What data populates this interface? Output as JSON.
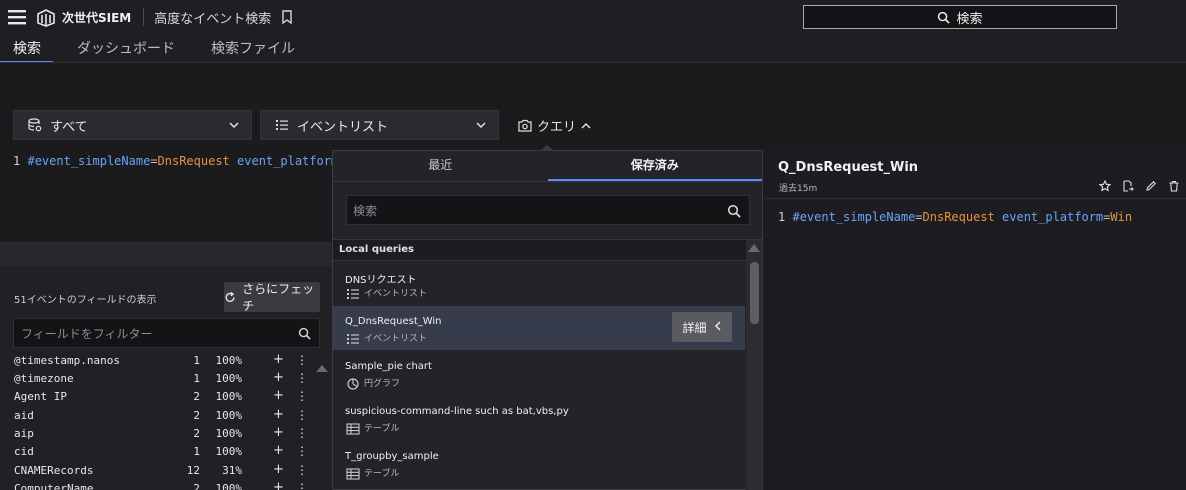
{
  "header": {
    "brand": "次世代SIEM",
    "page_title": "高度なイベント検索",
    "global_search_label": "検索"
  },
  "nav_tabs": [
    {
      "label": "検索",
      "active": true
    },
    {
      "label": "ダッシュボード",
      "active": false
    },
    {
      "label": "検索ファイル",
      "active": false
    }
  ],
  "controls": {
    "repo_select": "すべて",
    "view_select": "イベントリスト",
    "query_toggle": "クエリ"
  },
  "editor": {
    "line_number": "1",
    "tokens": [
      {
        "type": "kw",
        "text": "#event_simpleName"
      },
      {
        "type": "op",
        "text": "="
      },
      {
        "type": "val",
        "text": "DnsRequest"
      },
      {
        "type": "op",
        "text": " "
      },
      {
        "type": "kw",
        "text": "event_platform"
      },
      {
        "type": "op",
        "text": "="
      }
    ]
  },
  "fields": {
    "count_label": "51イベントのフィールドの表示",
    "fetch_label": "さらにフェッチ",
    "filter_placeholder": "フィールドをフィルター",
    "rows": [
      {
        "name": "@timestamp.nanos",
        "count": "1",
        "pct": "100%"
      },
      {
        "name": "@timezone",
        "count": "1",
        "pct": "100%"
      },
      {
        "name": "Agent IP",
        "count": "2",
        "pct": "100%"
      },
      {
        "name": "aid",
        "count": "2",
        "pct": "100%"
      },
      {
        "name": "aip",
        "count": "2",
        "pct": "100%"
      },
      {
        "name": "cid",
        "count": "1",
        "pct": "100%"
      },
      {
        "name": "CNAMERecords",
        "count": "12",
        "pct": "31%"
      },
      {
        "name": "ComputerName",
        "count": "2",
        "pct": "100%"
      }
    ]
  },
  "query_dropdown": {
    "tabs": [
      {
        "label": "最近",
        "active": false
      },
      {
        "label": "保存済み",
        "active": true
      }
    ],
    "search_placeholder": "検索",
    "section_label": "Local queries",
    "detail_button": "詳細",
    "items": [
      {
        "title": "DNSリクエスト",
        "kind": "イベントリスト",
        "icon": "list-icon",
        "selected": false
      },
      {
        "title": "Q_DnsRequest_Win",
        "kind": "イベントリスト",
        "icon": "list-icon",
        "selected": true
      },
      {
        "title": "Sample_pie chart",
        "kind": "円グラフ",
        "icon": "pie-chart-icon",
        "selected": false
      },
      {
        "title": "suspicious-command-line such as bat,vbs,py",
        "kind": "テーブル",
        "icon": "table-icon",
        "selected": false
      },
      {
        "title": "T_groupby_sample",
        "kind": "テーブル",
        "icon": "table-icon",
        "selected": false
      }
    ]
  },
  "detail": {
    "title": "Q_DnsRequest_Win",
    "subtitle": "過去15m",
    "line_number": "1",
    "tokens": [
      {
        "type": "kw",
        "text": "#event_simpleName"
      },
      {
        "type": "op",
        "text": "="
      },
      {
        "type": "val",
        "text": "DnsRequest"
      },
      {
        "type": "op",
        "text": " "
      },
      {
        "type": "kw",
        "text": "event_platform"
      },
      {
        "type": "op",
        "text": "="
      },
      {
        "type": "val",
        "text": "Win"
      }
    ]
  },
  "colors": {
    "accent": "#5b8cf5",
    "keyword": "#6aa3f8",
    "value": "#e8923f"
  }
}
